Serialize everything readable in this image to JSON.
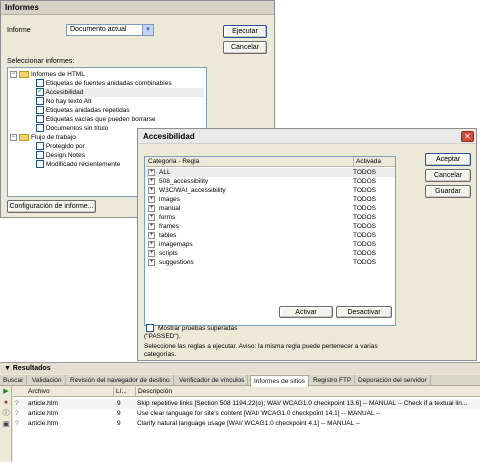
{
  "informes": {
    "title": "Informes",
    "informe_label": "Informe",
    "informe_value": "Documento actual",
    "ejecutar": "Ejecutar",
    "cancelar": "Cancelar",
    "seleccionar_label": "Seleccionar informes:",
    "tree": [
      {
        "label": "Informes de HTML",
        "kind": "folder",
        "expander": "−"
      },
      {
        "label": "Etiquetas de fuentes anidadas combinables",
        "kind": "item",
        "checked": false
      },
      {
        "label": "Accesibilidad",
        "kind": "item",
        "checked": true,
        "selected": true
      },
      {
        "label": "No hay texto Alt",
        "kind": "item",
        "checked": false
      },
      {
        "label": "Etiquetas anidadas repetidas",
        "kind": "item",
        "checked": false
      },
      {
        "label": "Etiquetas vacías que pueden borrarse",
        "kind": "item",
        "checked": false
      },
      {
        "label": "Documentos sin título",
        "kind": "item",
        "checked": false
      },
      {
        "label": "Flujo de trabajo",
        "kind": "folder",
        "expander": "−"
      },
      {
        "label": "Protegido por",
        "kind": "item",
        "checked": false
      },
      {
        "label": "Design Notes",
        "kind": "item",
        "checked": false
      },
      {
        "label": "Modificado recientemente",
        "kind": "item",
        "checked": false
      }
    ],
    "config_button": "Configuración de informe..."
  },
  "accesibilidad": {
    "title": "Accesibilidad",
    "close_glyph": "✕",
    "col_categoria": "Categoría - Regla",
    "col_activada": "Activada",
    "rows": [
      {
        "name": "ALL",
        "active": "TODOS"
      },
      {
        "name": "508_accessibility",
        "active": "TODOS"
      },
      {
        "name": "W3C/WAI_accessibility",
        "active": "TODOS"
      },
      {
        "name": "images",
        "active": "TODOS"
      },
      {
        "name": "manual",
        "active": "TODOS"
      },
      {
        "name": "forms",
        "active": "TODOS"
      },
      {
        "name": "frames",
        "active": "TODOS"
      },
      {
        "name": "tables",
        "active": "TODOS"
      },
      {
        "name": "imagemaps",
        "active": "TODOS"
      },
      {
        "name": "scripts",
        "active": "TODOS"
      },
      {
        "name": "suggestions",
        "active": "TODOS"
      }
    ],
    "aceptar": "Aceptar",
    "cancelar": "Cancelar",
    "guardar": "Guardar",
    "activar": "Activar",
    "desactivar": "Desactivar",
    "mostrar_label": "Mostrar pruebas superadas",
    "mostrar_label2": "(\"PASSED\").",
    "hint_line1": "Seleccione las reglas a ejecutar. Aviso: la misma regla puede pertenecer a varias",
    "hint_line2": "categorías."
  },
  "resultados": {
    "title": "Resultados",
    "tabs": [
      "Buscar",
      "Validación",
      "Revisión del navegador de destino",
      "Verificador de vínculos",
      "Informes de sitios",
      "Registro FTP",
      "Depuración del servidor"
    ],
    "active_tab": "Informes de sitios",
    "col_archivo": "Archivo",
    "col_linea": "Lí...",
    "col_desc": "Descripción",
    "rows": [
      {
        "file": "article.htm",
        "line": "9",
        "desc": "Skip repetitive links  [Section 508 1194.22(o); WAI/ WCAG1.0 checkpoint 13.6]  -- MANUAL -- Check if a textual lin..."
      },
      {
        "file": "article.htm",
        "line": "9",
        "desc": "Use clear language for site's content  [WAI/ WCAG1.0 checkpoint 14.1]  -- MANUAL --"
      },
      {
        "file": "article.htm",
        "line": "9",
        "desc": "Clarify natural language usage  [WAI/ WCAG1.0 checkpoint 4.1]  -- MANUAL --"
      }
    ]
  }
}
